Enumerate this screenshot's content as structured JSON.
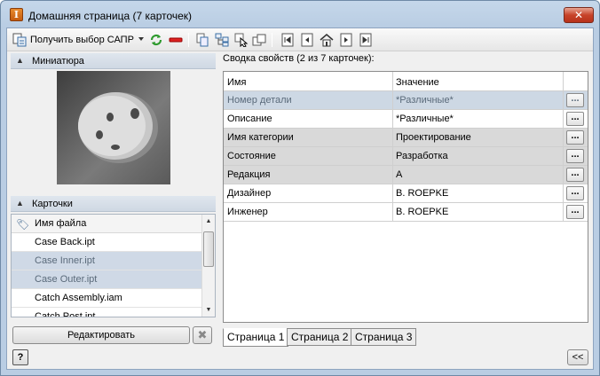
{
  "window": {
    "title": "Домашняя страница (7 карточек)",
    "app_icon_letter": "I",
    "close_glyph": "✕"
  },
  "toolbar": {
    "get_selection_label": "Получить выбор САПР",
    "icons": [
      "get-selection-icon",
      "refresh-icon",
      "remove-icon",
      "copy-card-icon",
      "tree-icon",
      "select-cursor-icon",
      "duplicate-icon",
      "first-page-icon",
      "prev-page-icon",
      "home-page-icon",
      "next-page-icon",
      "last-page-icon"
    ]
  },
  "left": {
    "thumbnail_header": "Миниатюра",
    "cards_header": "Карточки",
    "cards_column": "Имя файла",
    "cards": [
      {
        "name": "Case Back.ipt",
        "selected": false
      },
      {
        "name": "Case Inner.ipt",
        "selected": true
      },
      {
        "name": "Case Outer.ipt",
        "selected": true
      },
      {
        "name": "Catch Assembly.iam",
        "selected": false
      },
      {
        "name": "Catch Post.ipt",
        "selected": false
      }
    ],
    "edit_label": "Редактировать",
    "delete_glyph": "✖"
  },
  "right": {
    "summary": "Сводка свойств (2 из 7 карточек):",
    "col_name": "Имя",
    "col_value": "Значение",
    "ellipsis": "...",
    "rows": [
      {
        "name": "Номер детали",
        "value": "*Различные*",
        "style": "blue"
      },
      {
        "name": "Описание",
        "value": "*Различные*",
        "style": "white"
      },
      {
        "name": "Имя категории",
        "value": "Проектирование",
        "style": "gray"
      },
      {
        "name": "Состояние",
        "value": "Разработка",
        "style": "gray"
      },
      {
        "name": "Редакция",
        "value": "A",
        "style": "gray"
      },
      {
        "name": "Дизайнер",
        "value": "B. ROEPKE",
        "style": "white"
      },
      {
        "name": "Инженер",
        "value": "B. ROEPKE",
        "style": "white"
      }
    ],
    "tabs": [
      "Страница 1",
      "Страница 2",
      "Страница 3"
    ],
    "active_tab": 0
  },
  "footer": {
    "help_glyph": "?",
    "collapse_label": "<<"
  }
}
